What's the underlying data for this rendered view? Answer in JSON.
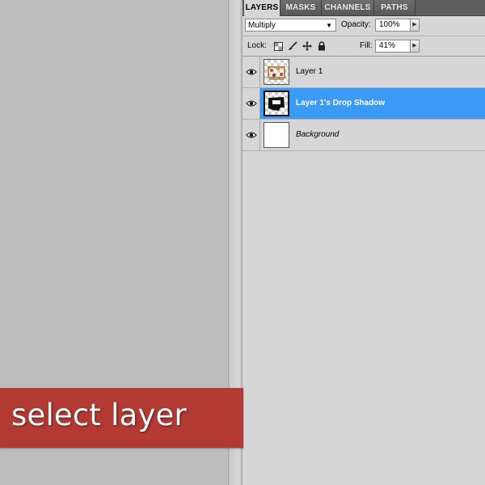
{
  "tabs": [
    {
      "label": "LAYERS",
      "active": true
    },
    {
      "label": "MASKS",
      "active": false
    },
    {
      "label": "CHANNELS",
      "active": false
    },
    {
      "label": "PATHS",
      "active": false
    }
  ],
  "options": {
    "blend_mode": "Multiply",
    "opacity_label": "Opacity:",
    "opacity_value": "100%",
    "lock_label": "Lock:",
    "fill_label": "Fill:",
    "fill_value": "41%"
  },
  "layers": [
    {
      "name": "Layer 1",
      "visible": true,
      "selected": false,
      "thumbnail": "artwork-thumbnail"
    },
    {
      "name": "Layer 1's Drop Shadow",
      "visible": true,
      "selected": true,
      "thumbnail": "shadow-thumbnail"
    },
    {
      "name": "Background",
      "visible": true,
      "selected": false,
      "thumbnail": "white-thumbnail"
    }
  ],
  "banner": {
    "text": "select layer"
  },
  "colors": {
    "banner_bg": "#b23a33",
    "selection": "#3a9af6",
    "panel_bg": "#d6d6d6",
    "canvas_bg": "#bdbdbd"
  }
}
